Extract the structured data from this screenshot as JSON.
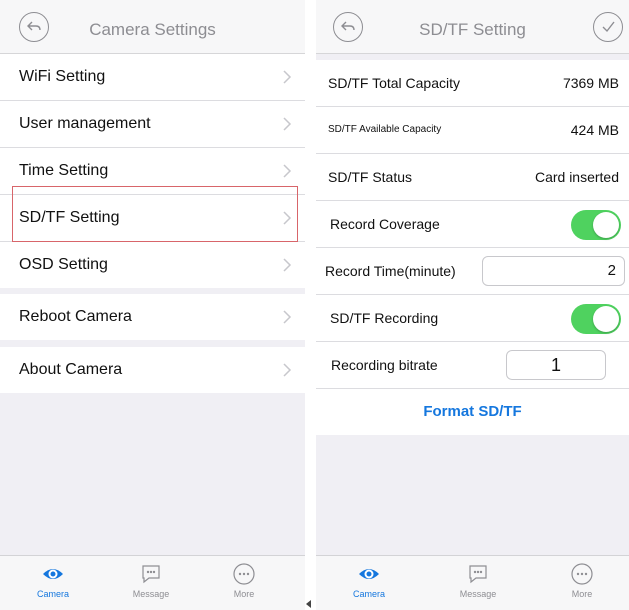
{
  "left": {
    "title": "Camera Settings",
    "menu": [
      {
        "label": "WiFi Setting"
      },
      {
        "label": "User management"
      },
      {
        "label": "Time Setting"
      },
      {
        "label": "SD/TF Setting",
        "highlighted": true
      },
      {
        "label": "OSD Setting"
      }
    ],
    "menu2": [
      {
        "label": "Reboot Camera"
      }
    ],
    "menu3": [
      {
        "label": "About Camera"
      }
    ]
  },
  "right": {
    "title": "SD/TF Setting",
    "rows": {
      "total_label": "SD/TF Total Capacity",
      "total_value": "7369 MB",
      "avail_label": "SD/TF Available Capacity",
      "avail_value": "424 MB",
      "status_label": "SD/TF Status",
      "status_value": "Card inserted",
      "coverage_label": "Record Coverage",
      "coverage_on": true,
      "time_label": "Record Time(minute)",
      "time_value": "2",
      "recording_label": "SD/TF Recording",
      "recording_on": true,
      "bitrate_label": "Recording bitrate",
      "bitrate_value": "1"
    },
    "format_label": "Format SD/TF"
  },
  "tabbar": {
    "camera": "Camera",
    "message": "Message",
    "more": "More"
  },
  "colors": {
    "accent": "#1577de",
    "toggle_on": "#4fd25f",
    "highlight": "#d8656a"
  }
}
